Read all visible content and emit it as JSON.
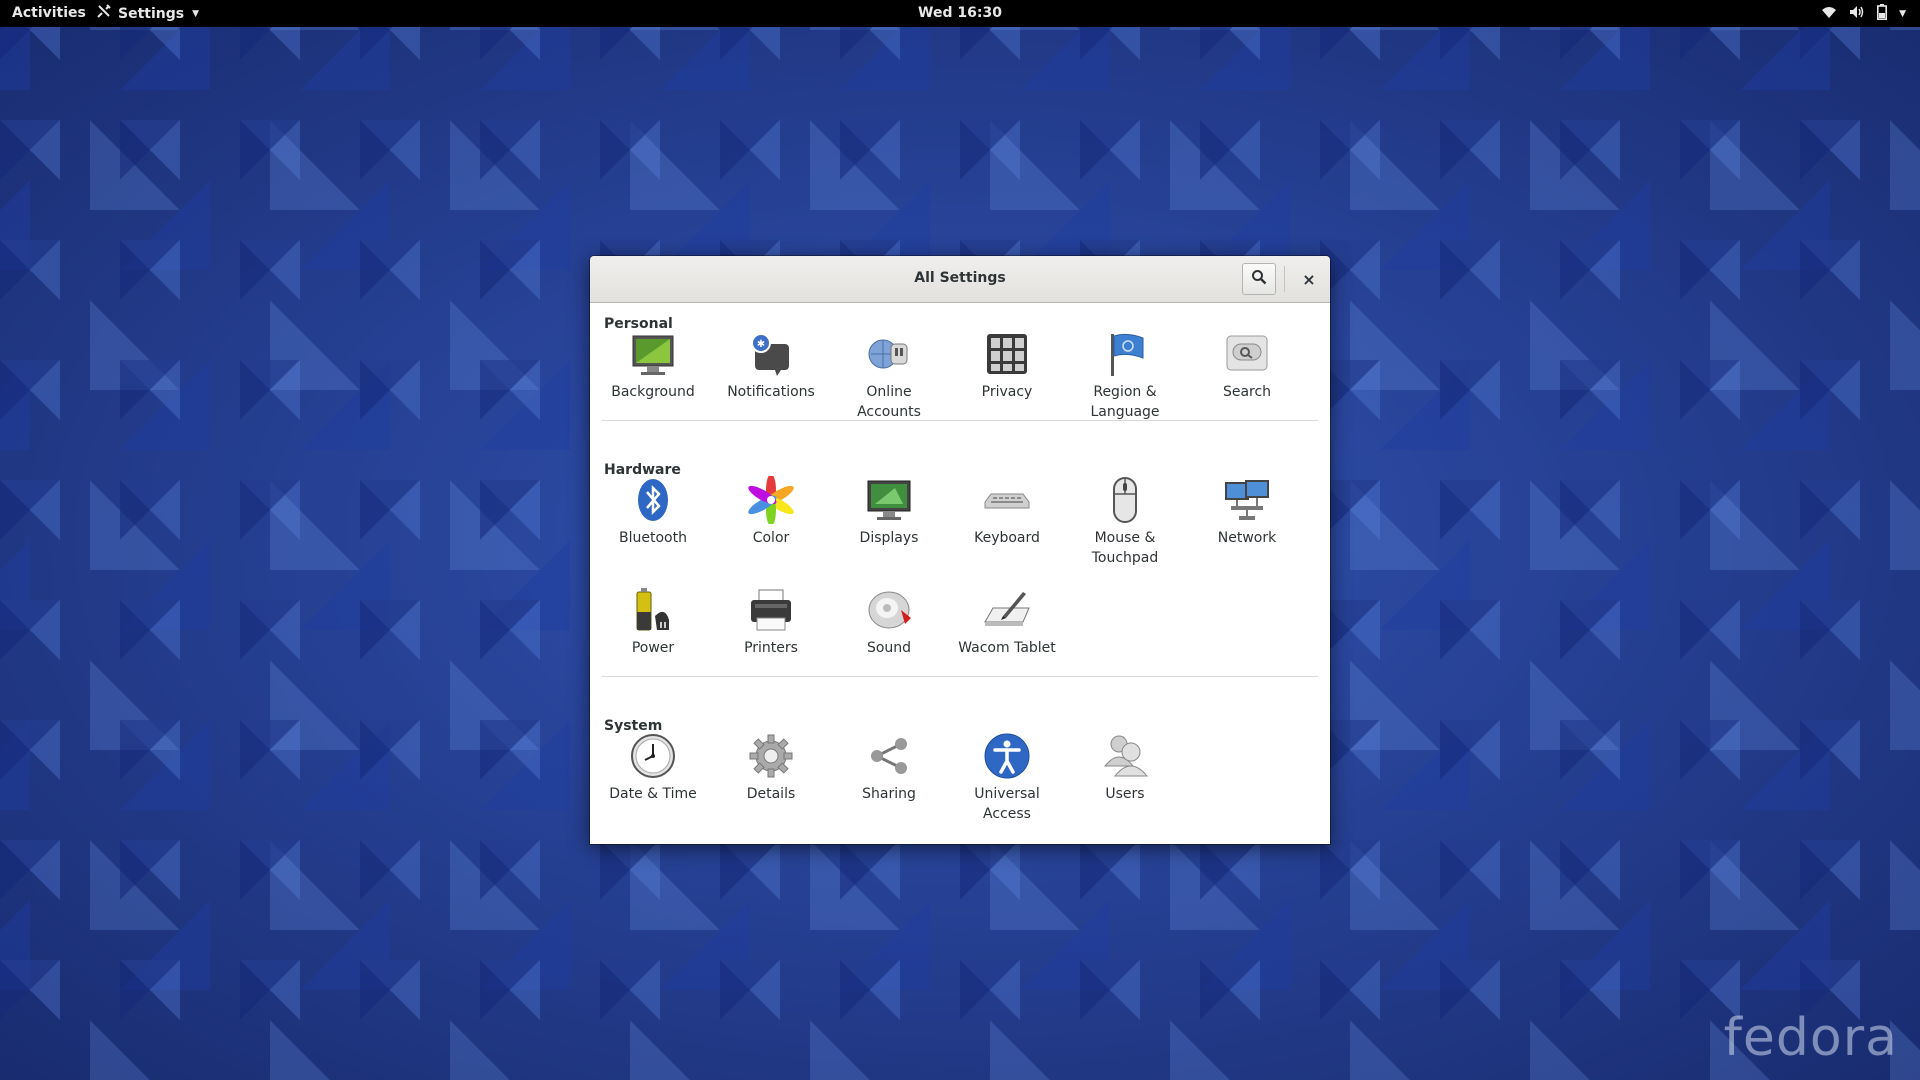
{
  "topbar": {
    "activities": "Activities",
    "app_menu": "Settings",
    "clock": "Wed 16:30",
    "status_icons": [
      "wifi-icon",
      "volume-icon",
      "battery-icon"
    ]
  },
  "window": {
    "title": "All Settings",
    "search_button": "search-icon",
    "close_button": "×"
  },
  "sections": {
    "personal": {
      "title": "Personal",
      "items": [
        {
          "label": "Background",
          "icon": "background-icon"
        },
        {
          "label": "Notifications",
          "icon": "notifications-icon"
        },
        {
          "label": "Online\nAccounts",
          "icon": "online-accounts-icon"
        },
        {
          "label": "Privacy",
          "icon": "privacy-icon"
        },
        {
          "label": "Region &\nLanguage",
          "icon": "region-language-icon"
        },
        {
          "label": "Search",
          "icon": "search-settings-icon"
        }
      ]
    },
    "hardware": {
      "title": "Hardware",
      "items": [
        {
          "label": "Bluetooth",
          "icon": "bluetooth-icon"
        },
        {
          "label": "Color",
          "icon": "color-icon"
        },
        {
          "label": "Displays",
          "icon": "displays-icon"
        },
        {
          "label": "Keyboard",
          "icon": "keyboard-icon"
        },
        {
          "label": "Mouse &\nTouchpad",
          "icon": "mouse-touchpad-icon"
        },
        {
          "label": "Network",
          "icon": "network-icon"
        },
        {
          "label": "Power",
          "icon": "power-icon"
        },
        {
          "label": "Printers",
          "icon": "printers-icon"
        },
        {
          "label": "Sound",
          "icon": "sound-icon"
        },
        {
          "label": "Wacom Tablet",
          "icon": "wacom-tablet-icon"
        }
      ]
    },
    "system": {
      "title": "System",
      "items": [
        {
          "label": "Date & Time",
          "icon": "date-time-icon"
        },
        {
          "label": "Details",
          "icon": "details-icon"
        },
        {
          "label": "Sharing",
          "icon": "sharing-icon"
        },
        {
          "label": "Universal\nAccess",
          "icon": "universal-access-icon"
        },
        {
          "label": "Users",
          "icon": "users-icon"
        }
      ]
    }
  },
  "desktop": {
    "watermark": "fedora"
  },
  "colors": {
    "desktop_blue": "#2f4fae",
    "topbar": "#000000",
    "window_bg": "#ffffff",
    "text": "#2e3436"
  }
}
